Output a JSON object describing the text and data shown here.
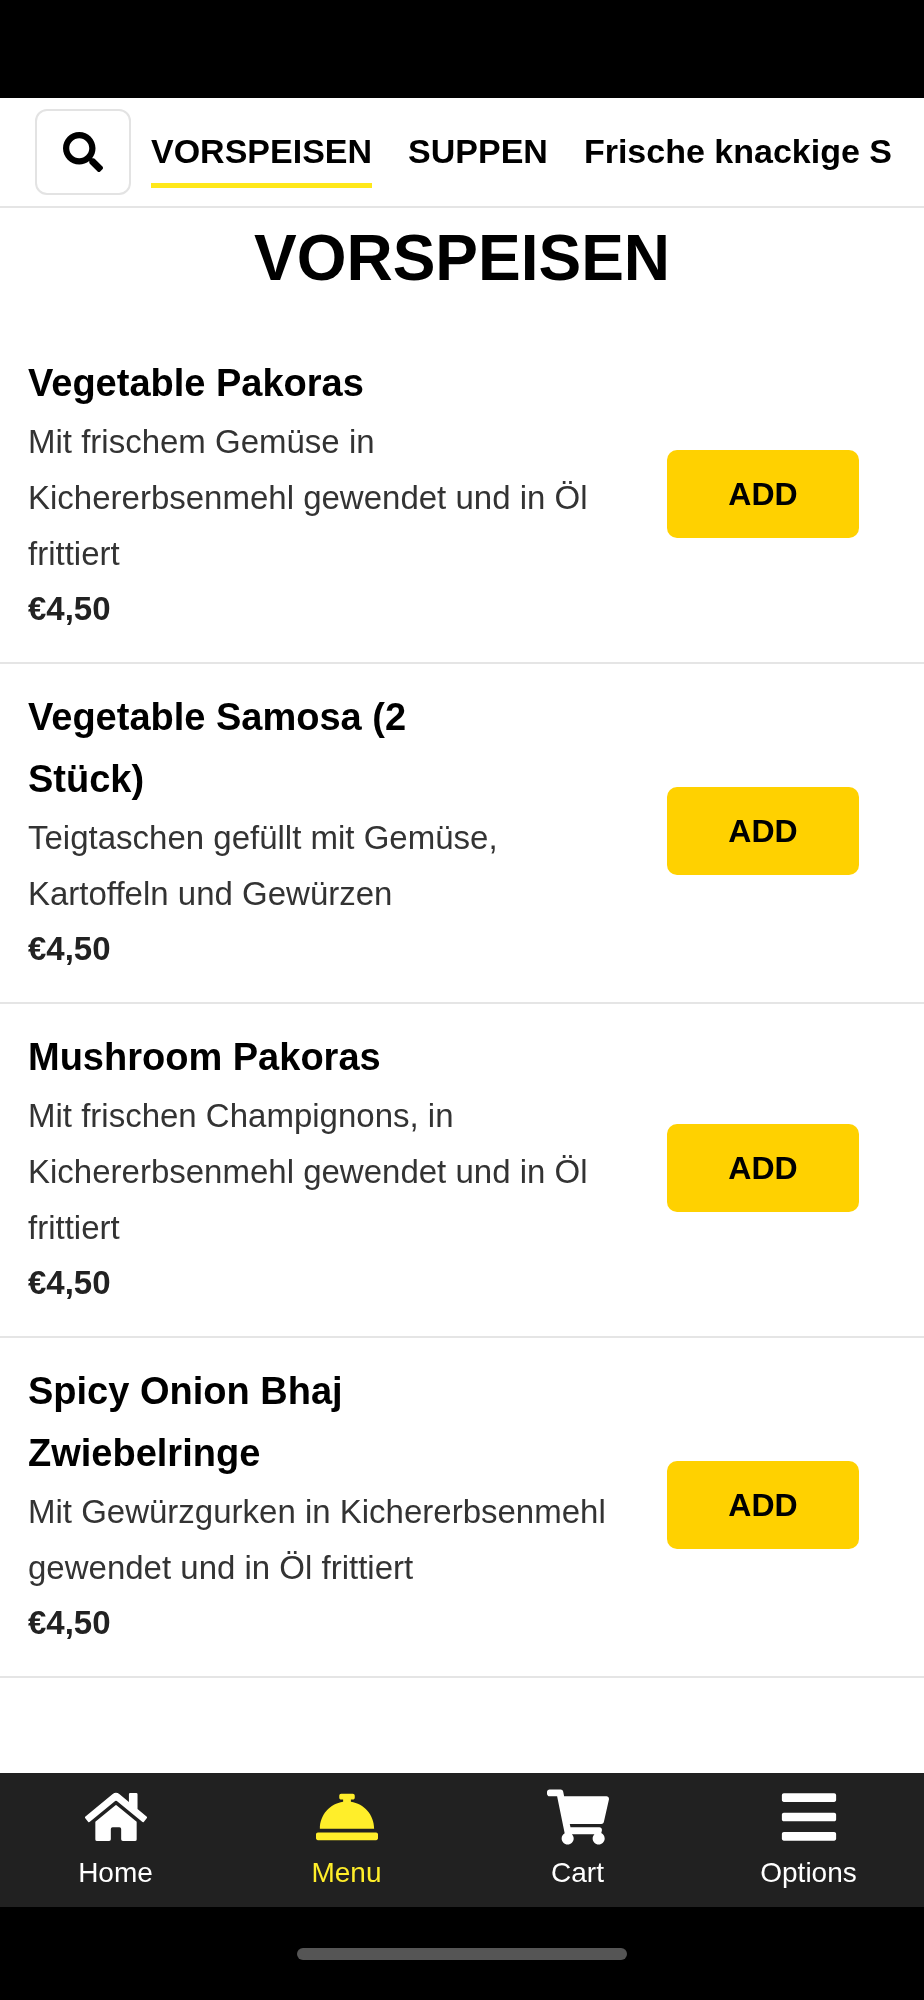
{
  "tabs": [
    {
      "label": "VORSPEISEN",
      "selected": true
    },
    {
      "label": "SUPPEN",
      "selected": false
    },
    {
      "label": "Frische knackige S",
      "selected": false
    }
  ],
  "section_title": "VORSPEISEN",
  "items": [
    {
      "name": "Vegetable Pakoras",
      "description": "Mit frischem Gemüse in Kichererbsenmehl gewendet und in Öl frittiert",
      "price": "€4,50",
      "button": "ADD"
    },
    {
      "name": "Vegetable Samosa (2 Stück)",
      "description": "Teigtaschen gefüllt mit Gemüse, Kartoffeln und Gewürzen",
      "price": "€4,50",
      "button": "ADD"
    },
    {
      "name": "Mushroom Pakoras",
      "description": "Mit frischen Champignons, in Kichererbsenmehl gewendet und in Öl frittiert",
      "price": "€4,50",
      "button": "ADD"
    },
    {
      "name": "Spicy Onion Bhaj Zwiebelringe",
      "description": "Mit Gewürzgurken in Kichererbsenmehl gewendet und in Öl frittiert",
      "price": "€4,50",
      "button": "ADD"
    }
  ],
  "nav": [
    {
      "kind": "home",
      "label": "Home",
      "selected": false
    },
    {
      "kind": "menu",
      "label": "Menu",
      "selected": true
    },
    {
      "kind": "cart",
      "label": "Cart",
      "selected": false
    },
    {
      "kind": "options",
      "label": "Options",
      "selected": false
    }
  ]
}
